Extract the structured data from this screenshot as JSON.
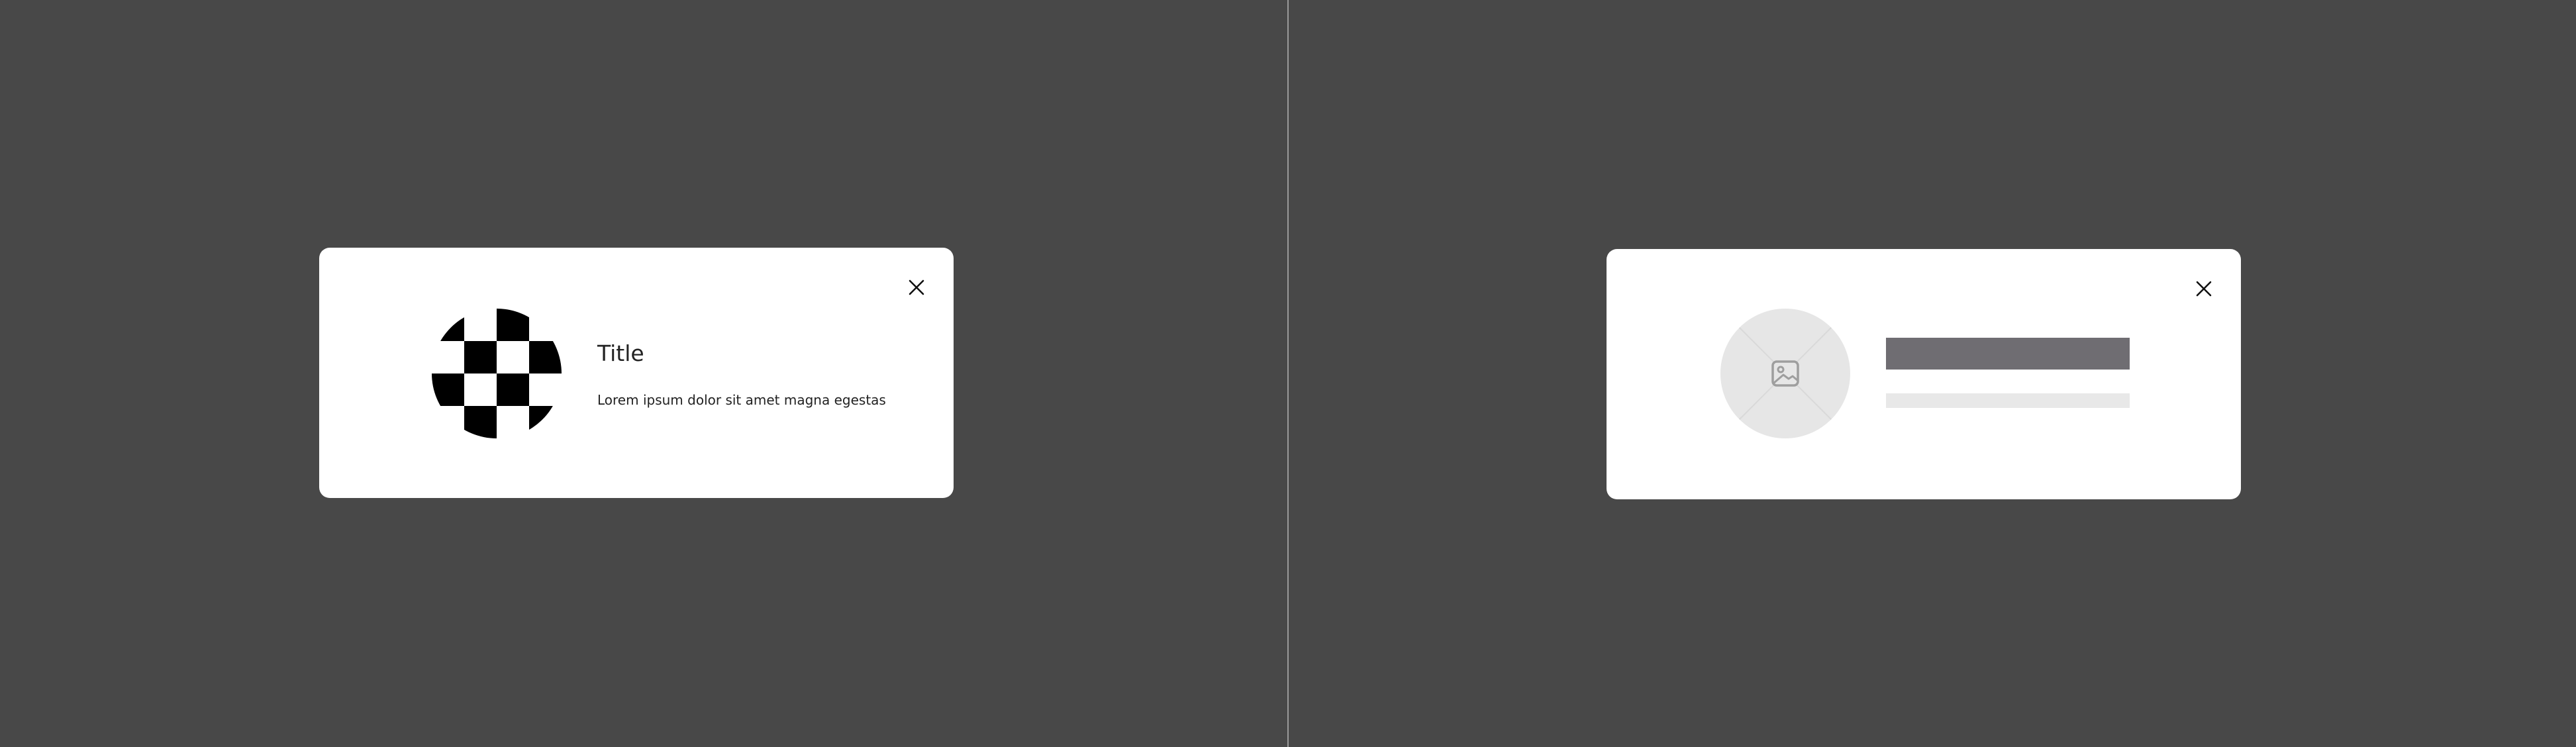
{
  "filled_card": {
    "title": "Title",
    "body": "Lorem ipsum dolor sit amet magna egestas",
    "close_icon": "close-icon",
    "image_icon": "checkerboard-image"
  },
  "skeleton_card": {
    "close_icon": "close-icon",
    "image_icon": "image-placeholder-icon"
  },
  "colors": {
    "background": "#484848",
    "card": "#ffffff",
    "skeleton_title": "#6f6d72",
    "skeleton_line": "#e8e8e8",
    "image_placeholder": "#e6e6e6"
  }
}
